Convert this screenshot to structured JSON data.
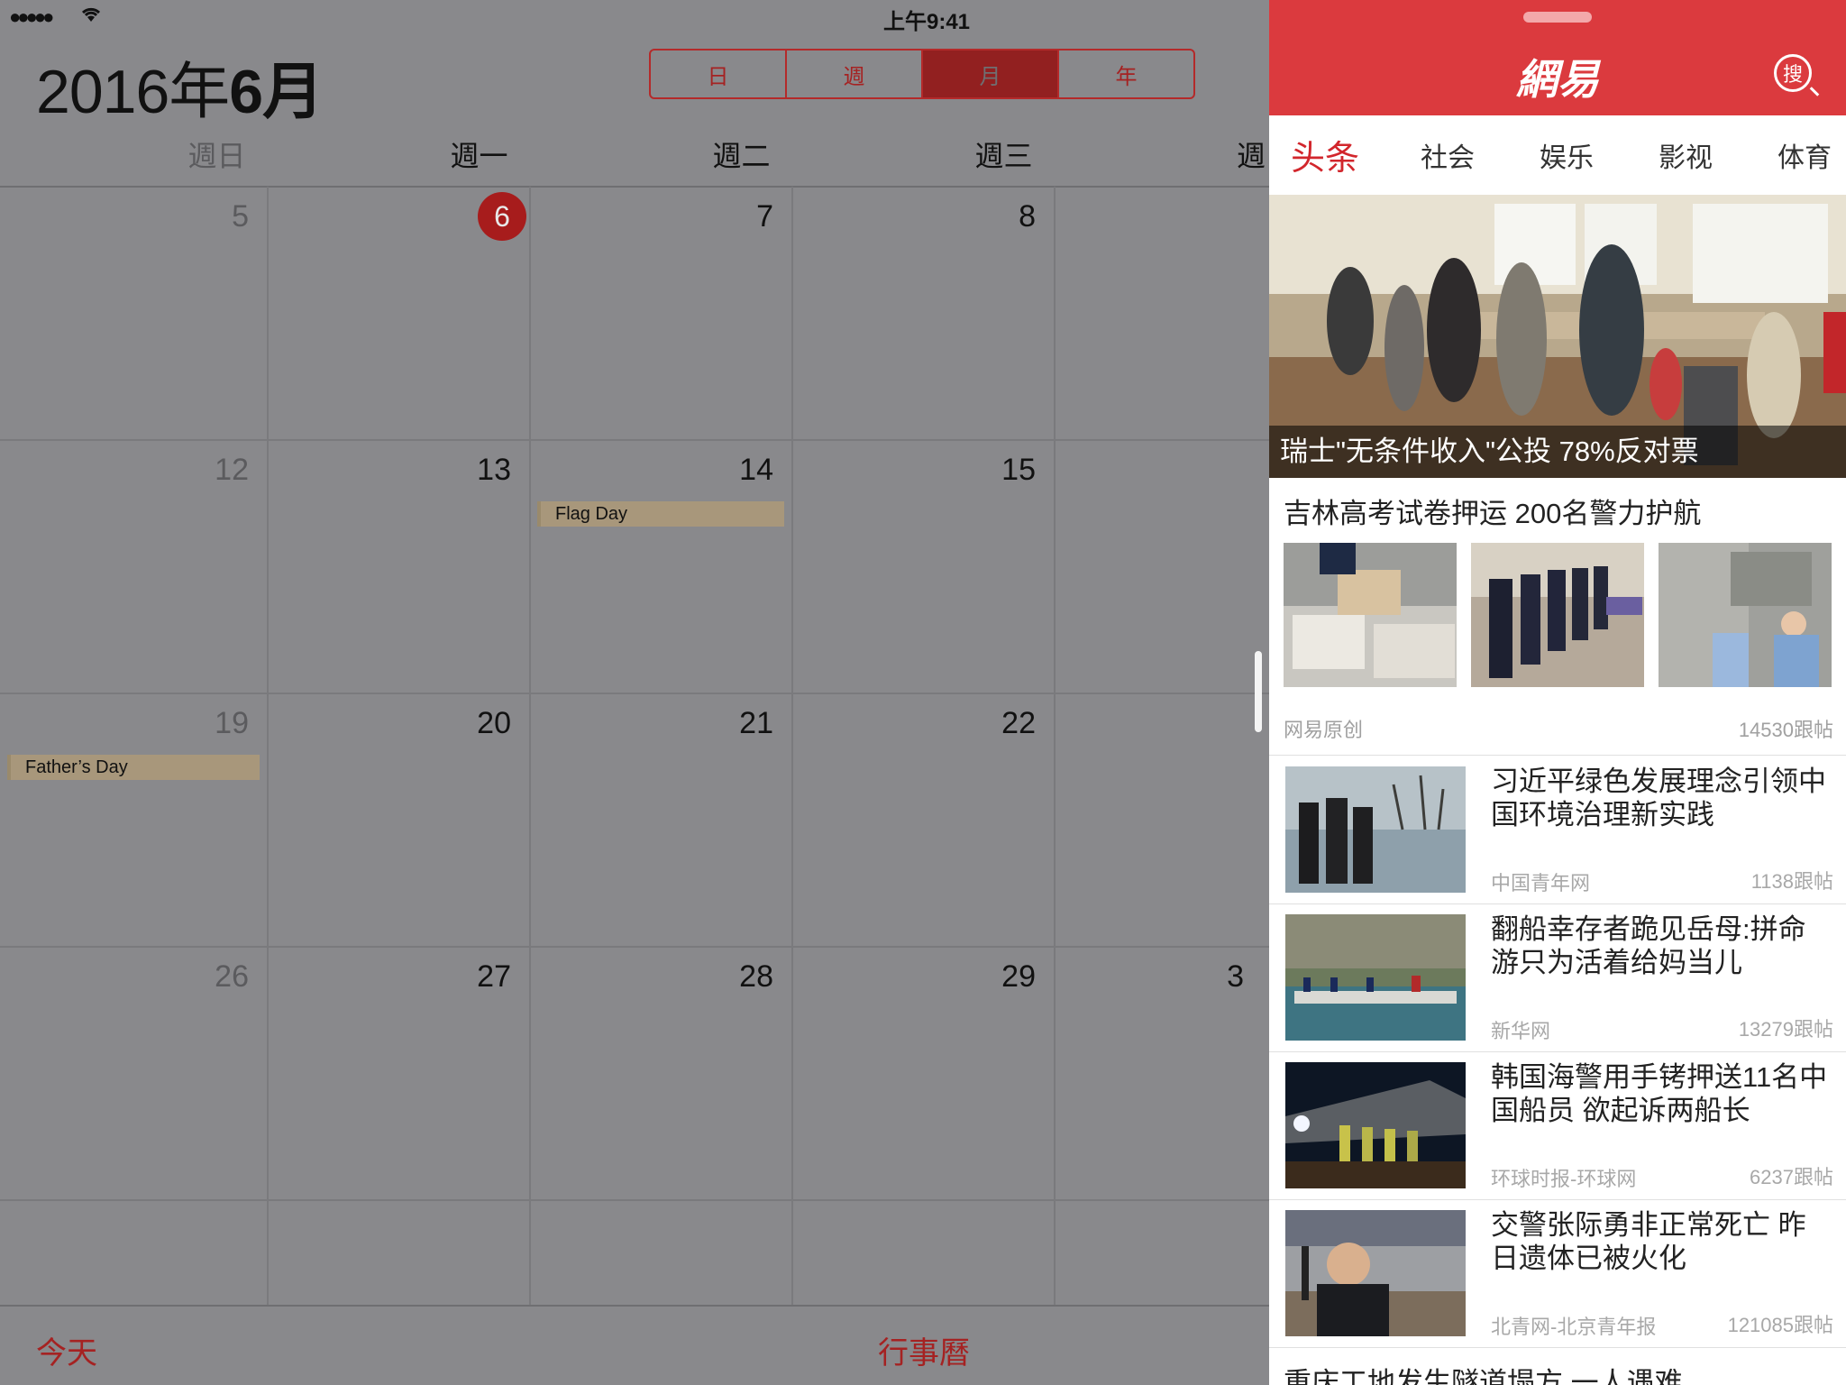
{
  "status_bar": {
    "signal": "●●●●●",
    "time": "上午9:41"
  },
  "calendar": {
    "year_label": "2016年",
    "month_label": "6月",
    "view_tabs": [
      {
        "label": "日",
        "active": false
      },
      {
        "label": "週",
        "active": false
      },
      {
        "label": "月",
        "active": true
      },
      {
        "label": "年",
        "active": false
      }
    ],
    "weekdays": [
      "週日",
      "週一",
      "週二",
      "週三",
      "週"
    ],
    "weeks": [
      [
        "5",
        "6",
        "7",
        "8",
        ""
      ],
      [
        "12",
        "13",
        "14",
        "15",
        ""
      ],
      [
        "19",
        "20",
        "21",
        "22",
        ""
      ],
      [
        "26",
        "27",
        "28",
        "29",
        "3"
      ]
    ],
    "today": "6",
    "events": [
      {
        "label": "Flag Day",
        "date": "14"
      },
      {
        "label": "Father’s Day",
        "date": "19"
      }
    ],
    "bottom": {
      "today_button": "今天",
      "calendars_button": "行事曆"
    }
  },
  "news": {
    "logo": "網易",
    "search_label": "搜",
    "tabs": [
      {
        "label": "头条",
        "active": true
      },
      {
        "label": "社会",
        "active": false
      },
      {
        "label": "娱乐",
        "active": false
      },
      {
        "label": "影视",
        "active": false
      },
      {
        "label": "体育",
        "active": false
      }
    ],
    "hero": {
      "caption": "瑞士\"无条件收入\"公投 78%反对票"
    },
    "photo_story": {
      "title": "吉林高考试卷押运 200名警力护航",
      "source": "网易原创",
      "replies": "14530跟帖"
    },
    "articles": [
      {
        "title": "习近平绿色发展理念引领中国环境治理新实践",
        "source": "中国青年网",
        "replies": "1138跟帖"
      },
      {
        "title": "翻船幸存者跪见岳母:拼命游只为活着给妈当儿",
        "source": "新华网",
        "replies": "13279跟帖"
      },
      {
        "title": "韩国海警用手铐押送11名中国船员 欲起诉两船长",
        "source": "环球时报-环球网",
        "replies": "6237跟帖"
      },
      {
        "title": "交警张际勇非正常死亡 昨日遗体已被火化",
        "source": "北青网-北京青年报",
        "replies": "121085跟帖"
      }
    ],
    "partial_headline": "重庆工地发生隧道塌方 一人遇难"
  }
}
